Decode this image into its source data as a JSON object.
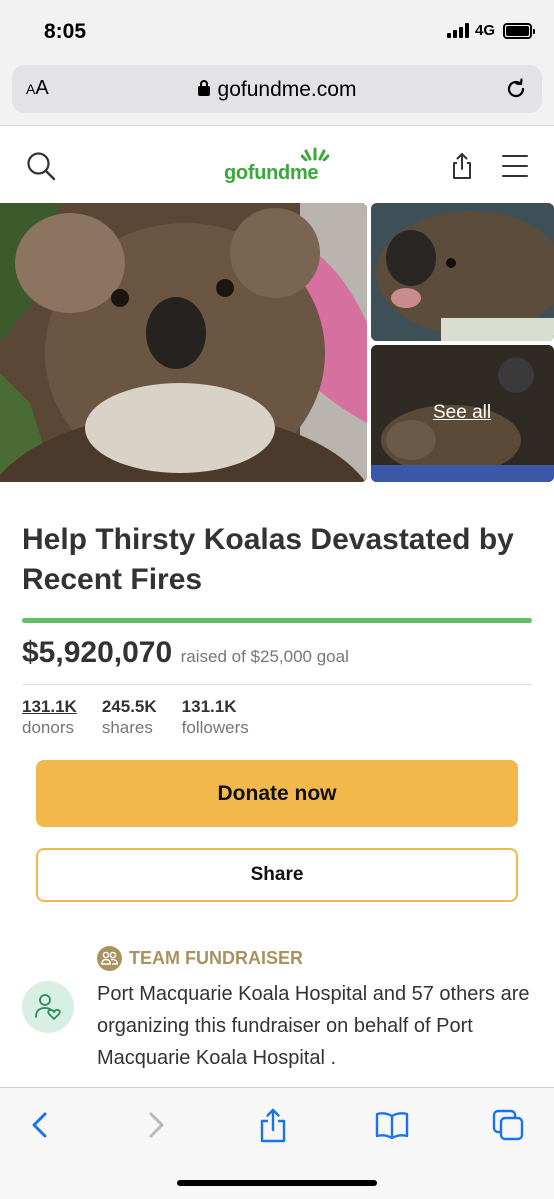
{
  "status_bar": {
    "time": "8:05",
    "network": "4G"
  },
  "browser": {
    "font_size_label_small": "A",
    "font_size_label_big": "A",
    "url": "gofundme.com"
  },
  "site": {
    "logo": "gofundme"
  },
  "photos": {
    "see_all": "See all"
  },
  "campaign": {
    "title": "Help Thirsty Koalas Devastated by Recent Fires",
    "raised_amount": "$5,920,070",
    "raised_goal": "raised of $25,000 goal",
    "progress_fraction": 1.0,
    "stats": [
      {
        "value": "131.1K",
        "label": "donors"
      },
      {
        "value": "245.5K",
        "label": "shares"
      },
      {
        "value": "131.1K",
        "label": "followers"
      }
    ],
    "donate_label": "Donate now",
    "share_label": "Share",
    "team_label": "TEAM FUNDRAISER",
    "team_description": "Port Macquarie Koala Hospital and 57 others are organizing this fundraiser on behalf of Port Macquarie Koala Hospital ."
  },
  "colors": {
    "brand_green": "#3aa83a",
    "donate_yellow": "#f2b84b",
    "progress_green": "#5fbf64",
    "ios_blue": "#1a73e8"
  },
  "icons": [
    "search-icon",
    "share-upload-icon",
    "hamburger-menu-icon",
    "reload-icon",
    "back-icon",
    "forward-icon",
    "bookmarks-icon",
    "tabs-icon"
  ]
}
